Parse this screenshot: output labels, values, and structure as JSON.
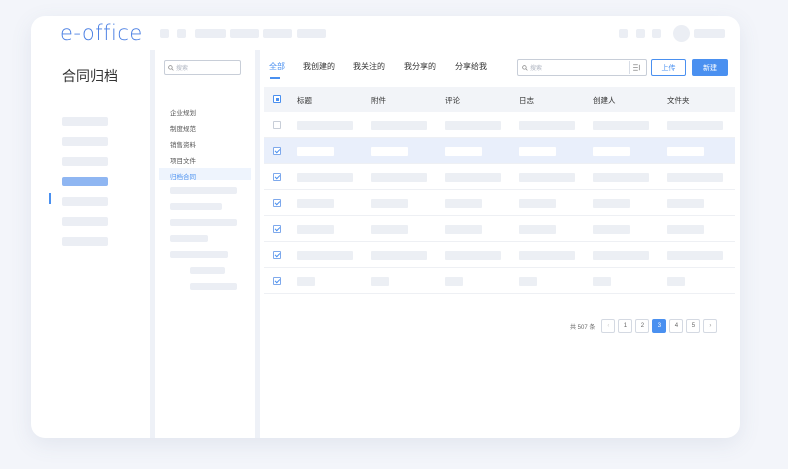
{
  "header": {
    "logo": "e-office"
  },
  "left_nav": {
    "title": "合同归档"
  },
  "tree": {
    "search_placeholder": "搜索",
    "items": [
      {
        "label": "企业规划",
        "active": false
      },
      {
        "label": "制度规范",
        "active": false
      },
      {
        "label": "销售资料",
        "active": false
      },
      {
        "label": "项目文件",
        "active": false
      },
      {
        "label": "归档合同",
        "active": true
      }
    ]
  },
  "tabs": [
    {
      "label": "全部",
      "active": true
    },
    {
      "label": "我创建的",
      "active": false
    },
    {
      "label": "我关注的",
      "active": false
    },
    {
      "label": "我分享的",
      "active": false
    },
    {
      "label": "分享给我",
      "active": false
    }
  ],
  "toolbar": {
    "search_placeholder": "搜索",
    "upload_label": "上传",
    "new_label": "新建"
  },
  "table": {
    "columns": [
      "标题",
      "附件",
      "评论",
      "日志",
      "创建人",
      "文件夹"
    ],
    "rows": [
      {
        "checked": false,
        "selected": false
      },
      {
        "checked": true,
        "selected": true
      },
      {
        "checked": true,
        "selected": false
      },
      {
        "checked": true,
        "selected": false
      },
      {
        "checked": true,
        "selected": false
      },
      {
        "checked": true,
        "selected": false
      },
      {
        "checked": true,
        "selected": false
      }
    ]
  },
  "pagination": {
    "total_text": "共 507 条",
    "pages": [
      "1",
      "2",
      "3",
      "4",
      "5"
    ],
    "current_page": "3",
    "prev_icon": "chevron-left-icon",
    "next_icon": "chevron-right-icon"
  },
  "colors": {
    "accent": "#4a90f0",
    "selected_row": "#e9effb",
    "placeholder": "#eceff4"
  }
}
